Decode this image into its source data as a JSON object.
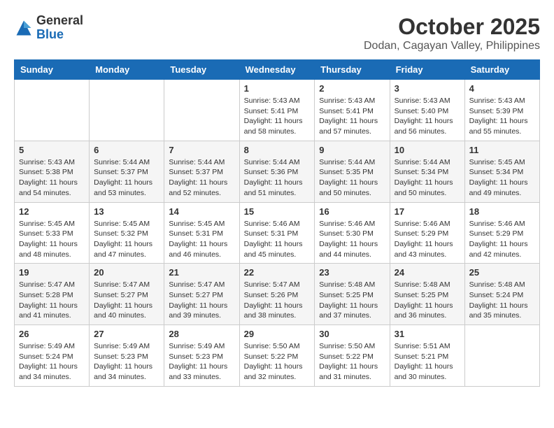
{
  "logo": {
    "general": "General",
    "blue": "Blue"
  },
  "title": "October 2025",
  "subtitle": "Dodan, Cagayan Valley, Philippines",
  "days_of_week": [
    "Sunday",
    "Monday",
    "Tuesday",
    "Wednesday",
    "Thursday",
    "Friday",
    "Saturday"
  ],
  "weeks": [
    [
      {
        "day": "",
        "sunrise": "",
        "sunset": "",
        "daylight": ""
      },
      {
        "day": "",
        "sunrise": "",
        "sunset": "",
        "daylight": ""
      },
      {
        "day": "",
        "sunrise": "",
        "sunset": "",
        "daylight": ""
      },
      {
        "day": "1",
        "sunrise": "Sunrise: 5:43 AM",
        "sunset": "Sunset: 5:41 PM",
        "daylight": "Daylight: 11 hours and 58 minutes."
      },
      {
        "day": "2",
        "sunrise": "Sunrise: 5:43 AM",
        "sunset": "Sunset: 5:41 PM",
        "daylight": "Daylight: 11 hours and 57 minutes."
      },
      {
        "day": "3",
        "sunrise": "Sunrise: 5:43 AM",
        "sunset": "Sunset: 5:40 PM",
        "daylight": "Daylight: 11 hours and 56 minutes."
      },
      {
        "day": "4",
        "sunrise": "Sunrise: 5:43 AM",
        "sunset": "Sunset: 5:39 PM",
        "daylight": "Daylight: 11 hours and 55 minutes."
      }
    ],
    [
      {
        "day": "5",
        "sunrise": "Sunrise: 5:43 AM",
        "sunset": "Sunset: 5:38 PM",
        "daylight": "Daylight: 11 hours and 54 minutes."
      },
      {
        "day": "6",
        "sunrise": "Sunrise: 5:44 AM",
        "sunset": "Sunset: 5:37 PM",
        "daylight": "Daylight: 11 hours and 53 minutes."
      },
      {
        "day": "7",
        "sunrise": "Sunrise: 5:44 AM",
        "sunset": "Sunset: 5:37 PM",
        "daylight": "Daylight: 11 hours and 52 minutes."
      },
      {
        "day": "8",
        "sunrise": "Sunrise: 5:44 AM",
        "sunset": "Sunset: 5:36 PM",
        "daylight": "Daylight: 11 hours and 51 minutes."
      },
      {
        "day": "9",
        "sunrise": "Sunrise: 5:44 AM",
        "sunset": "Sunset: 5:35 PM",
        "daylight": "Daylight: 11 hours and 50 minutes."
      },
      {
        "day": "10",
        "sunrise": "Sunrise: 5:44 AM",
        "sunset": "Sunset: 5:34 PM",
        "daylight": "Daylight: 11 hours and 50 minutes."
      },
      {
        "day": "11",
        "sunrise": "Sunrise: 5:45 AM",
        "sunset": "Sunset: 5:34 PM",
        "daylight": "Daylight: 11 hours and 49 minutes."
      }
    ],
    [
      {
        "day": "12",
        "sunrise": "Sunrise: 5:45 AM",
        "sunset": "Sunset: 5:33 PM",
        "daylight": "Daylight: 11 hours and 48 minutes."
      },
      {
        "day": "13",
        "sunrise": "Sunrise: 5:45 AM",
        "sunset": "Sunset: 5:32 PM",
        "daylight": "Daylight: 11 hours and 47 minutes."
      },
      {
        "day": "14",
        "sunrise": "Sunrise: 5:45 AM",
        "sunset": "Sunset: 5:31 PM",
        "daylight": "Daylight: 11 hours and 46 minutes."
      },
      {
        "day": "15",
        "sunrise": "Sunrise: 5:46 AM",
        "sunset": "Sunset: 5:31 PM",
        "daylight": "Daylight: 11 hours and 45 minutes."
      },
      {
        "day": "16",
        "sunrise": "Sunrise: 5:46 AM",
        "sunset": "Sunset: 5:30 PM",
        "daylight": "Daylight: 11 hours and 44 minutes."
      },
      {
        "day": "17",
        "sunrise": "Sunrise: 5:46 AM",
        "sunset": "Sunset: 5:29 PM",
        "daylight": "Daylight: 11 hours and 43 minutes."
      },
      {
        "day": "18",
        "sunrise": "Sunrise: 5:46 AM",
        "sunset": "Sunset: 5:29 PM",
        "daylight": "Daylight: 11 hours and 42 minutes."
      }
    ],
    [
      {
        "day": "19",
        "sunrise": "Sunrise: 5:47 AM",
        "sunset": "Sunset: 5:28 PM",
        "daylight": "Daylight: 11 hours and 41 minutes."
      },
      {
        "day": "20",
        "sunrise": "Sunrise: 5:47 AM",
        "sunset": "Sunset: 5:27 PM",
        "daylight": "Daylight: 11 hours and 40 minutes."
      },
      {
        "day": "21",
        "sunrise": "Sunrise: 5:47 AM",
        "sunset": "Sunset: 5:27 PM",
        "daylight": "Daylight: 11 hours and 39 minutes."
      },
      {
        "day": "22",
        "sunrise": "Sunrise: 5:47 AM",
        "sunset": "Sunset: 5:26 PM",
        "daylight": "Daylight: 11 hours and 38 minutes."
      },
      {
        "day": "23",
        "sunrise": "Sunrise: 5:48 AM",
        "sunset": "Sunset: 5:25 PM",
        "daylight": "Daylight: 11 hours and 37 minutes."
      },
      {
        "day": "24",
        "sunrise": "Sunrise: 5:48 AM",
        "sunset": "Sunset: 5:25 PM",
        "daylight": "Daylight: 11 hours and 36 minutes."
      },
      {
        "day": "25",
        "sunrise": "Sunrise: 5:48 AM",
        "sunset": "Sunset: 5:24 PM",
        "daylight": "Daylight: 11 hours and 35 minutes."
      }
    ],
    [
      {
        "day": "26",
        "sunrise": "Sunrise: 5:49 AM",
        "sunset": "Sunset: 5:24 PM",
        "daylight": "Daylight: 11 hours and 34 minutes."
      },
      {
        "day": "27",
        "sunrise": "Sunrise: 5:49 AM",
        "sunset": "Sunset: 5:23 PM",
        "daylight": "Daylight: 11 hours and 34 minutes."
      },
      {
        "day": "28",
        "sunrise": "Sunrise: 5:49 AM",
        "sunset": "Sunset: 5:23 PM",
        "daylight": "Daylight: 11 hours and 33 minutes."
      },
      {
        "day": "29",
        "sunrise": "Sunrise: 5:50 AM",
        "sunset": "Sunset: 5:22 PM",
        "daylight": "Daylight: 11 hours and 32 minutes."
      },
      {
        "day": "30",
        "sunrise": "Sunrise: 5:50 AM",
        "sunset": "Sunset: 5:22 PM",
        "daylight": "Daylight: 11 hours and 31 minutes."
      },
      {
        "day": "31",
        "sunrise": "Sunrise: 5:51 AM",
        "sunset": "Sunset: 5:21 PM",
        "daylight": "Daylight: 11 hours and 30 minutes."
      },
      {
        "day": "",
        "sunrise": "",
        "sunset": "",
        "daylight": ""
      }
    ]
  ]
}
